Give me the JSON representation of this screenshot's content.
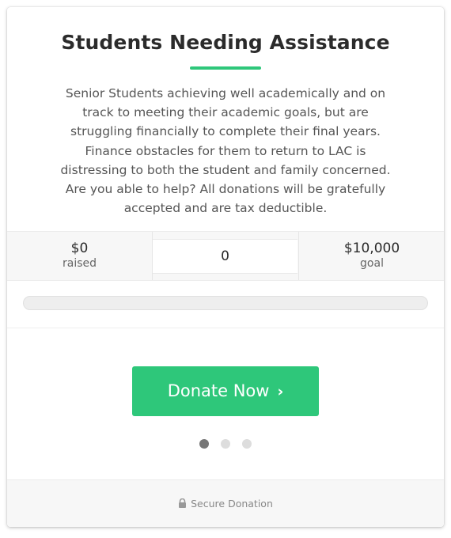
{
  "campaign": {
    "title": "Students Needing Assistance",
    "description": "Senior Students achieving well academically and on track to meeting their academic goals, but are struggling financially to complete their final years. Finance obstacles for them to return to LAC is distressing to both the student and family concerned. Are you able to help? All donations will be gratefully accepted and are tax deductible."
  },
  "stats": {
    "raised_value": "$0",
    "raised_label": "raised",
    "donor_count": "0",
    "goal_value": "$10,000",
    "goal_label": "goal"
  },
  "progress": {
    "fraction": 0
  },
  "donate": {
    "button_label": "Donate Now",
    "chevron": "›"
  },
  "pagination": {
    "total": 3,
    "active_index": 0
  },
  "footer": {
    "secure_label": "Secure Donation",
    "icon": "lock-icon"
  },
  "colors": {
    "accent": "#2ec77a",
    "dot_active": "#777777",
    "dot_inactive": "#dddddd"
  }
}
